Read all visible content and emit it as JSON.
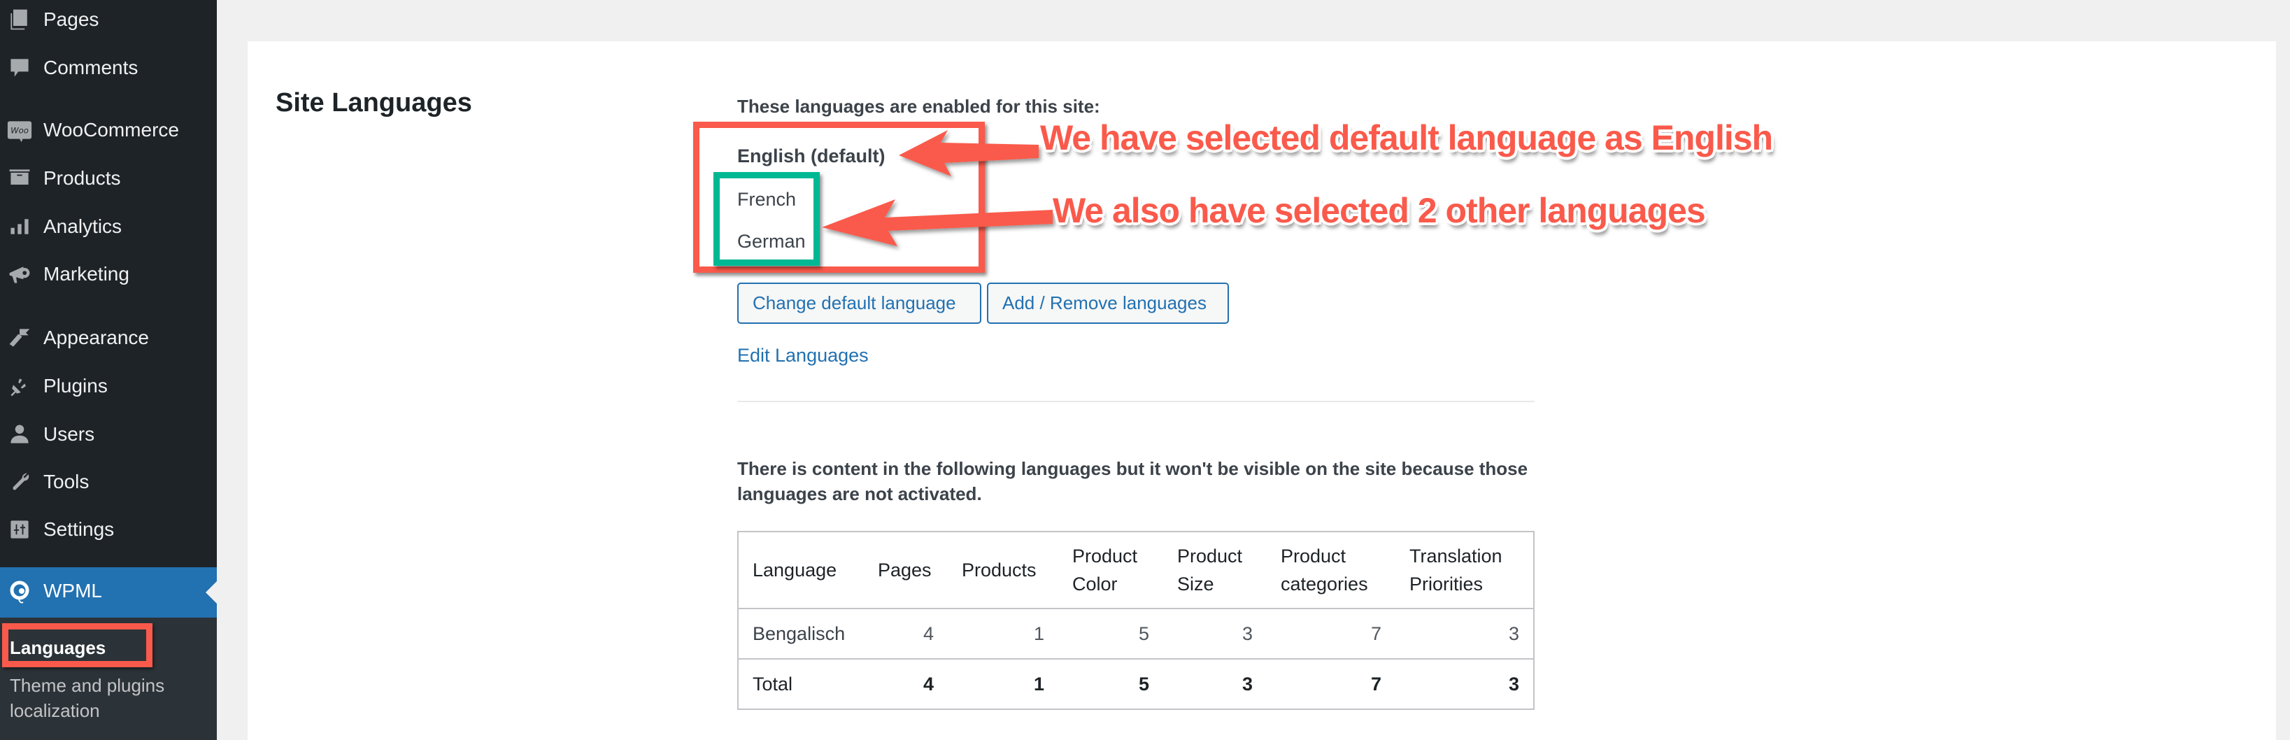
{
  "sidebar": {
    "items": [
      {
        "label": "Pages",
        "icon": "pages-icon"
      },
      {
        "label": "Comments",
        "icon": "comments-icon"
      },
      {
        "label": "WooCommerce",
        "icon": "woocommerce-icon"
      },
      {
        "label": "Products",
        "icon": "products-icon"
      },
      {
        "label": "Analytics",
        "icon": "analytics-icon"
      },
      {
        "label": "Marketing",
        "icon": "marketing-icon"
      },
      {
        "label": "Appearance",
        "icon": "appearance-icon"
      },
      {
        "label": "Plugins",
        "icon": "plugins-icon"
      },
      {
        "label": "Users",
        "icon": "users-icon"
      },
      {
        "label": "Tools",
        "icon": "tools-icon"
      },
      {
        "label": "Settings",
        "icon": "settings-icon"
      }
    ],
    "active": {
      "label": "WPML",
      "icon": "wpml-icon"
    },
    "submenu": [
      {
        "label": "Languages",
        "current": true
      },
      {
        "label": "Theme and plugins localization",
        "current": false
      }
    ],
    "woo_badge": "Woo"
  },
  "main": {
    "section_title": "Site Languages",
    "enabled_label": "These languages are enabled for this site:",
    "languages": {
      "default": "English (default)",
      "others": [
        "French",
        "German"
      ]
    },
    "buttons": {
      "change_default": "Change default language",
      "add_remove": "Add / Remove languages"
    },
    "edit_link": "Edit Languages",
    "notice": "There is content in the following languages but it won't be visible on the site because those languages are not activated.",
    "table": {
      "headers": [
        "Language",
        "Pages",
        "Products",
        "Product Color",
        "Product Size",
        "Product categories",
        "Translation Priorities"
      ],
      "rows": [
        [
          "Bengalisch",
          "4",
          "1",
          "5",
          "3",
          "7",
          "3"
        ]
      ],
      "total": [
        "Total",
        "4",
        "1",
        "5",
        "3",
        "7",
        "3"
      ]
    }
  },
  "annotations": {
    "callout_default": "We have selected default language as English",
    "callout_others": "We also have selected 2 other languages",
    "colors": {
      "red": "#fa5a4b",
      "green": "#00b894"
    }
  },
  "colors": {
    "sidebar_bg": "#1d2327",
    "active_bg": "#2271b1",
    "link": "#2271b1"
  }
}
